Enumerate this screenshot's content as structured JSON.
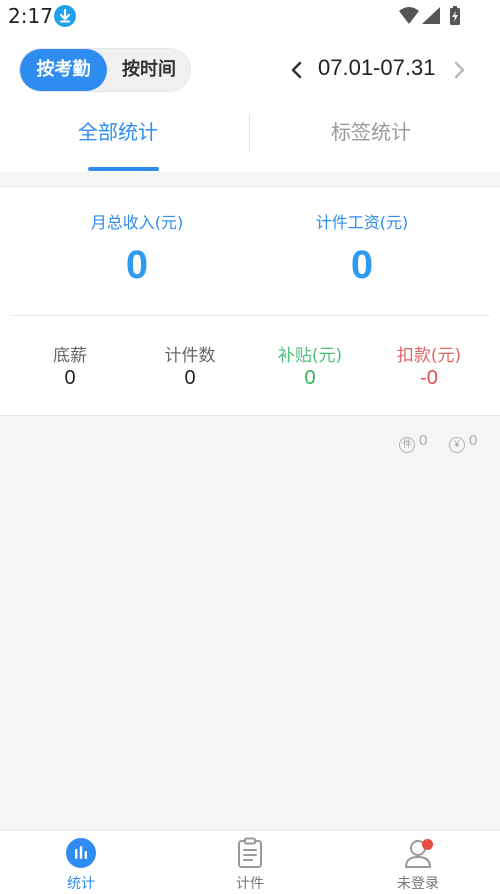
{
  "status_bar": {
    "time": "2:17",
    "icons": [
      "download-icon",
      "wifi-icon",
      "cellular-signal-icon",
      "battery-charging-icon"
    ]
  },
  "mode_toggle": {
    "active_label": "按考勤",
    "inactive_label": "按时间"
  },
  "date_nav": {
    "range": "07.01-07.31",
    "prev_icon": "chevron-left-icon",
    "next_icon": "chevron-right-icon"
  },
  "tabs": [
    {
      "label": "全部统计",
      "active": true
    },
    {
      "label": "标签统计",
      "active": false
    }
  ],
  "summary": {
    "monthly_income_label": "月总收入(元)",
    "monthly_income_value": "0",
    "piece_wage_label": "计件工资(元)",
    "piece_wage_value": "0",
    "items": [
      {
        "label": "底薪",
        "value": "0"
      },
      {
        "label": "计件数",
        "value": "0"
      },
      {
        "label": "补贴(元)",
        "value": "0"
      },
      {
        "label": "扣款(元)",
        "value": "-0"
      }
    ]
  },
  "counters": {
    "pieces_icon_text": "件",
    "pieces_value": "0",
    "money_icon_text": "¥",
    "money_value": "0"
  },
  "bottom_nav": [
    {
      "label": "统计",
      "icon": "bar-chart-icon",
      "active": true
    },
    {
      "label": "计件",
      "icon": "clipboard-icon",
      "active": false
    },
    {
      "label": "未登录",
      "icon": "user-icon",
      "active": false
    }
  ],
  "colors": {
    "accent": "#2f8cf0",
    "subsidy_green": "#2fb35a",
    "deduction_red": "#e05050",
    "notification_dot": "#e94b3c"
  }
}
